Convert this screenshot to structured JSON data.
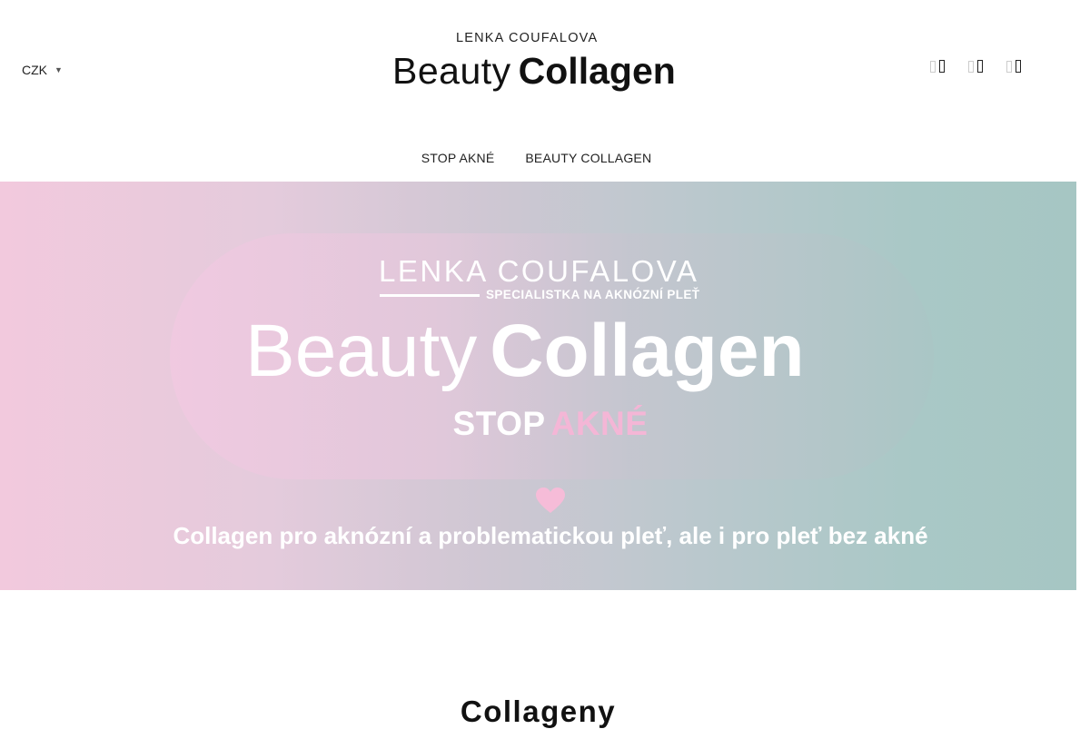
{
  "header": {
    "currency": "CZK",
    "logo_top": "LENKA COUFALOVA",
    "logo_word_light": "Beauty",
    "logo_word_bold": "Collagen",
    "icons": [
      "search-icon",
      "account-icon",
      "cart-icon"
    ]
  },
  "nav": {
    "items": [
      {
        "label": "STOP AKNÉ"
      },
      {
        "label": "BEAUTY COLLAGEN"
      }
    ]
  },
  "hero": {
    "brand": "LENKA COUFALOVA",
    "brand_sub": "SPECIALISTKA NA AKNÓZNÍ PLEŤ",
    "title_light": "Beauty",
    "title_bold": "Collagen",
    "stop_word": "STOP",
    "akne_word": "AKNÉ",
    "tagline": "Collagen pro aknózní a problematickou pleť, ale i pro pleť bez akné",
    "colors": {
      "gradient_left": "#f2c9dd",
      "gradient_right": "#a6c6c3",
      "accent_pink": "#f4b6d6"
    }
  },
  "section": {
    "title": "Collageny"
  }
}
